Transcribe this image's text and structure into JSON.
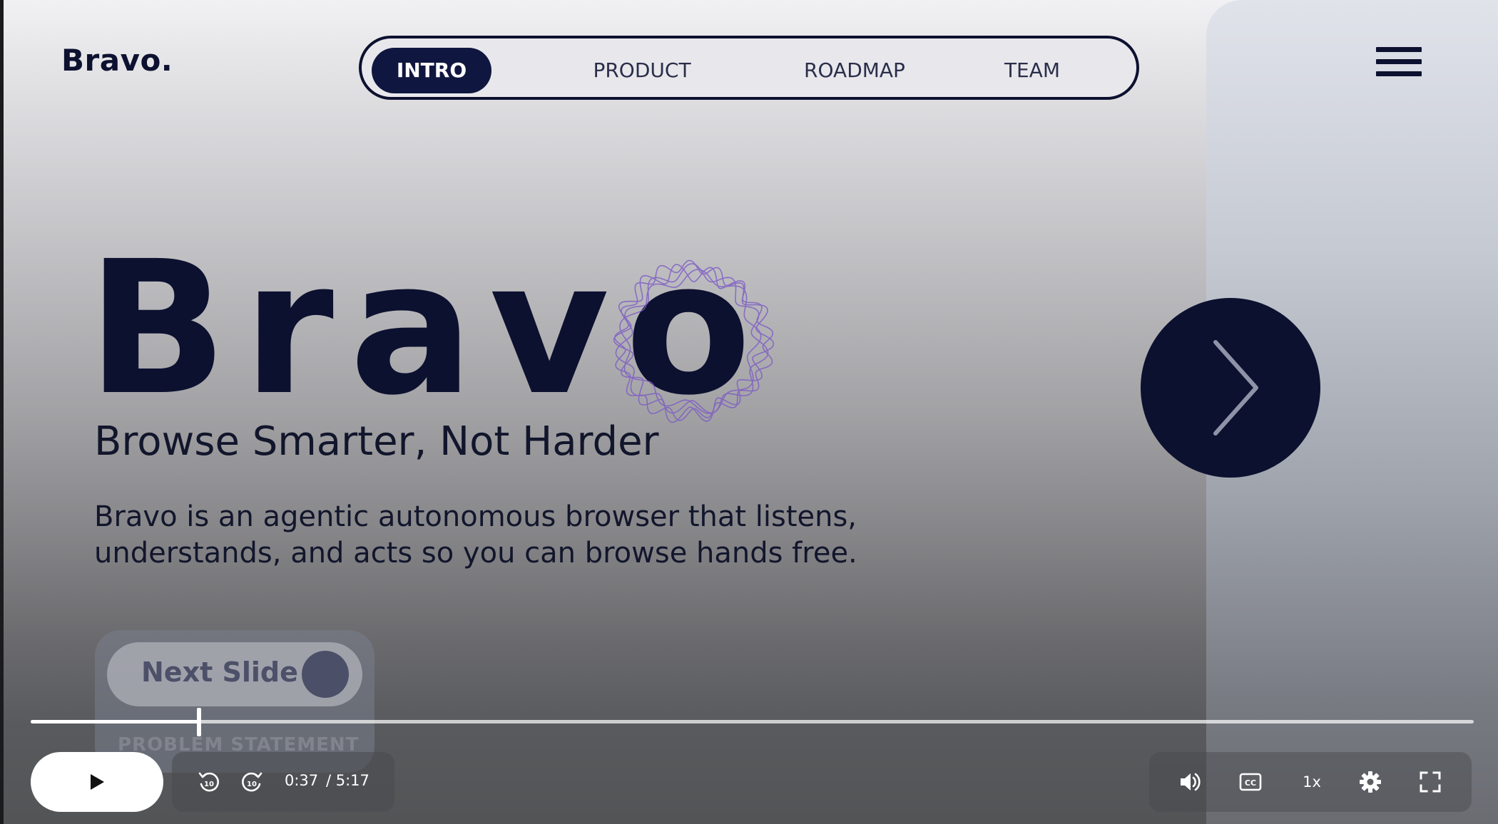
{
  "app": {
    "logo": "Bravo."
  },
  "nav": {
    "tabs": [
      {
        "label": "INTRO",
        "active": true
      },
      {
        "label": "PRODUCT",
        "active": false
      },
      {
        "label": "ROADMAP",
        "active": false
      },
      {
        "label": "TEAM",
        "active": false
      }
    ]
  },
  "menu": {
    "icon": "hamburger-menu-icon"
  },
  "hero": {
    "title": "Bravo",
    "subtitle": "Browse Smarter, Not Harder",
    "description_line1": "Bravo is an agentic autonomous browser that listens,",
    "description_line2": "understands, and acts so you can browse hands free."
  },
  "next_button": {
    "icon": "chevron-right-icon"
  },
  "next_card": {
    "label": "Next Slide",
    "section": "PROBLEM STATEMENT"
  },
  "player": {
    "current_time": "0:37",
    "duration": "/ 5:17",
    "progress": 0.1167,
    "speed": "1x",
    "icons": {
      "play": "play-icon",
      "rewind": "rewind-10-icon",
      "forward": "forward-10-icon",
      "volume": "volume-icon",
      "captions": "closed-captions-icon",
      "settings": "gear-icon",
      "fullscreen": "fullscreen-icon"
    }
  },
  "colors": {
    "navy": "#0d1130",
    "active_tab": "#0f1740",
    "wave": "#7d5bc4"
  }
}
